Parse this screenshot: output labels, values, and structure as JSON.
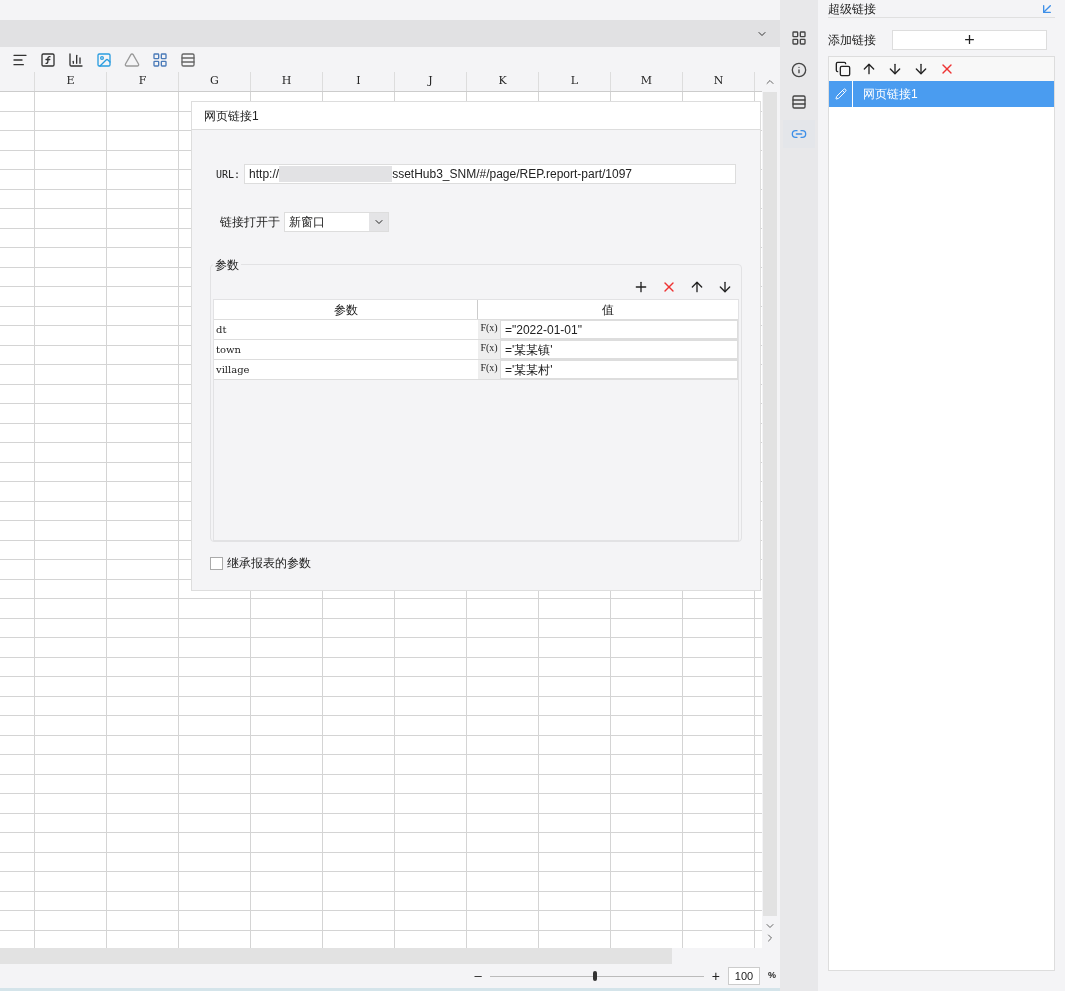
{
  "sheet": {
    "columns": [
      "E",
      "F",
      "G",
      "H",
      "I",
      "J",
      "K",
      "L",
      "M",
      "N"
    ],
    "zoom": {
      "minus": "–",
      "plus": "+",
      "level": 0.49,
      "value": "100",
      "unit": "%"
    }
  },
  "dialog": {
    "title": "网页链接1",
    "url_label": "URL:",
    "url_prefix": "http://",
    "url_suffix": "ssetHub3_SNM/#/page/REP.report-part/1097",
    "open_in_label": "链接打开于",
    "open_in_value": "新窗口",
    "params_legend": "参数",
    "table": {
      "columns": [
        "参数",
        "值"
      ],
      "rows": [
        {
          "name": "dt",
          "fx": "F(x)",
          "value": "=\"2022-01-01\""
        },
        {
          "name": "town",
          "fx": "F(x)",
          "value": "='某某镇'"
        },
        {
          "name": "village",
          "fx": "F(x)",
          "value": "='某某村'"
        }
      ]
    },
    "inherit": {
      "label": "继承报表的参数",
      "checked": false
    }
  },
  "side_tabs": [
    {
      "kind": "cell",
      "selected": false
    },
    {
      "kind": "info",
      "selected": false
    },
    {
      "kind": "widget",
      "selected": false
    },
    {
      "kind": "link",
      "selected": true
    }
  ],
  "panel": {
    "title": "超级链接",
    "add_label": "添加链接",
    "add_button": "+",
    "links": [
      {
        "label": "网页链接1",
        "selected": true
      }
    ]
  }
}
